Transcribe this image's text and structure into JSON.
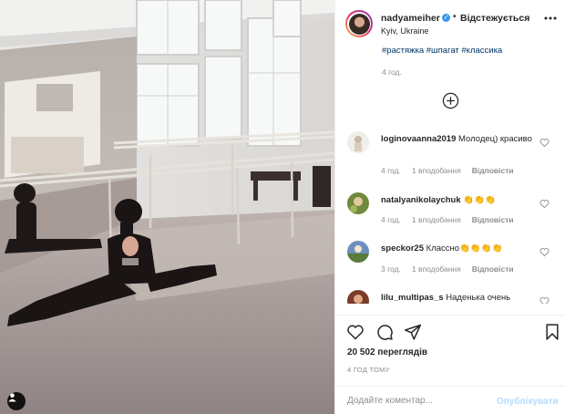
{
  "post": {
    "media": {
      "kind": "video-frame",
      "user_tag_icon": "person-icon"
    },
    "header": {
      "username": "nadyameiher",
      "verified_icon": "verified-badge-icon",
      "separator": "•",
      "follow_label": "Відстежується",
      "location": "Kyiv, Ukraine",
      "more_icon": "more-options-icon"
    },
    "caption": {
      "hashtags": "#растяжка #шпагат #классика",
      "time": "4 год."
    },
    "load_more_icon": "plus-circle-icon",
    "comments": [
      {
        "username": "loginovaanna2019",
        "text": " Молодец) красиво",
        "time": "4 год.",
        "likes": "1 вподобання",
        "reply": "Відповісти"
      },
      {
        "username": "natalyanikolaychuk",
        "text": " 👏👏👏",
        "time": "4 год.",
        "likes": "1 вподобання",
        "reply": "Відповісти"
      },
      {
        "username": "speckor25",
        "text": " Классно👏👏👏👏",
        "time": "3 год.",
        "likes": "1 вподобання",
        "reply": "Відповісти"
      },
      {
        "username": "lilu_multipas_s",
        "text": " Наденька очень красиво Только не станьте",
        "time": "",
        "likes": "",
        "reply": ""
      }
    ],
    "actions": {
      "like_icon": "heart-icon",
      "comment_icon": "comment-icon",
      "share_icon": "share-icon",
      "save_icon": "bookmark-icon"
    },
    "views": "20 502 переглядів",
    "posted_ago": "4 ГОД ТОМУ",
    "add_comment": {
      "placeholder": "Додайте коментар...",
      "publish_label": "Опублікувати"
    },
    "colors": {
      "link": "#003569",
      "meta": "#8e8e8e",
      "publish_disabled": "#b3dbff",
      "verified": "#3897f0"
    }
  }
}
